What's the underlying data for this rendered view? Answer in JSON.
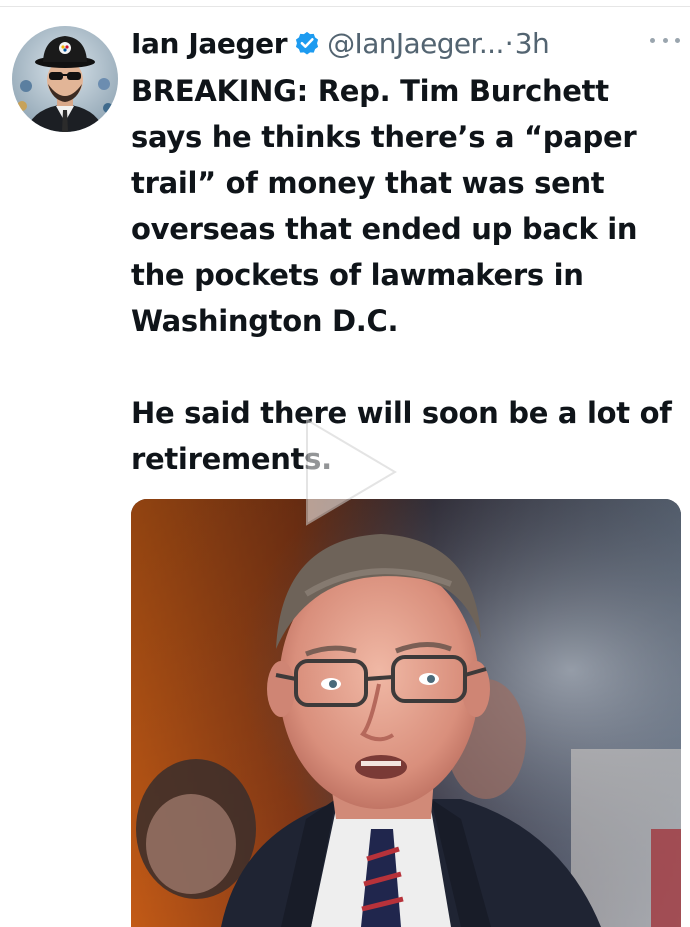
{
  "tweet": {
    "display_name": "Ian Jaeger",
    "handle": "@IanJaeger...",
    "separator": "·",
    "time": "3h",
    "paragraph_1": "BREAKING: Rep. Tim Burchett says he thinks there’s a “paper trail” of money that was sent overseas that ended up back in the pockets of lawmakers in Washington D.C.",
    "paragraph_2": "He said there will soon be a lot of retirements."
  },
  "icons": {
    "verified": "verified-badge-icon",
    "more": "more-options-icon",
    "play": "play-icon"
  },
  "colors": {
    "verified_blue": "#1d9bf0",
    "secondary_text": "#536471",
    "primary_text": "#0f1419"
  }
}
